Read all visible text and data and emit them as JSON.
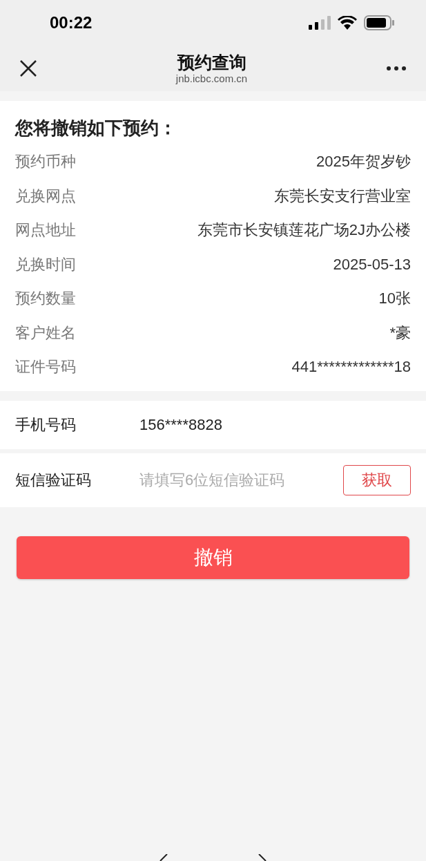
{
  "status_bar": {
    "time": "00:22"
  },
  "nav": {
    "title": "预约查询",
    "subtitle": "jnb.icbc.com.cn"
  },
  "summary": {
    "heading": "您将撤销如下预约：",
    "rows": [
      {
        "label": "预约币种",
        "value": "2025年贺岁钞"
      },
      {
        "label": "兑换网点",
        "value": "东莞长安支行营业室"
      },
      {
        "label": "网点地址",
        "value": "东莞市长安镇莲花广场2J办公楼"
      },
      {
        "label": "兑换时间",
        "value": "2025-05-13"
      },
      {
        "label": "预约数量",
        "value": "10张"
      },
      {
        "label": "客户姓名",
        "value": "*豪"
      },
      {
        "label": "证件号码",
        "value": "441*************18"
      }
    ]
  },
  "phone": {
    "label": "手机号码",
    "value": "156****8828"
  },
  "sms": {
    "label": "短信验证码",
    "placeholder": "请填写6位短信验证码",
    "button": "获取"
  },
  "cancel_button": "撤销"
}
